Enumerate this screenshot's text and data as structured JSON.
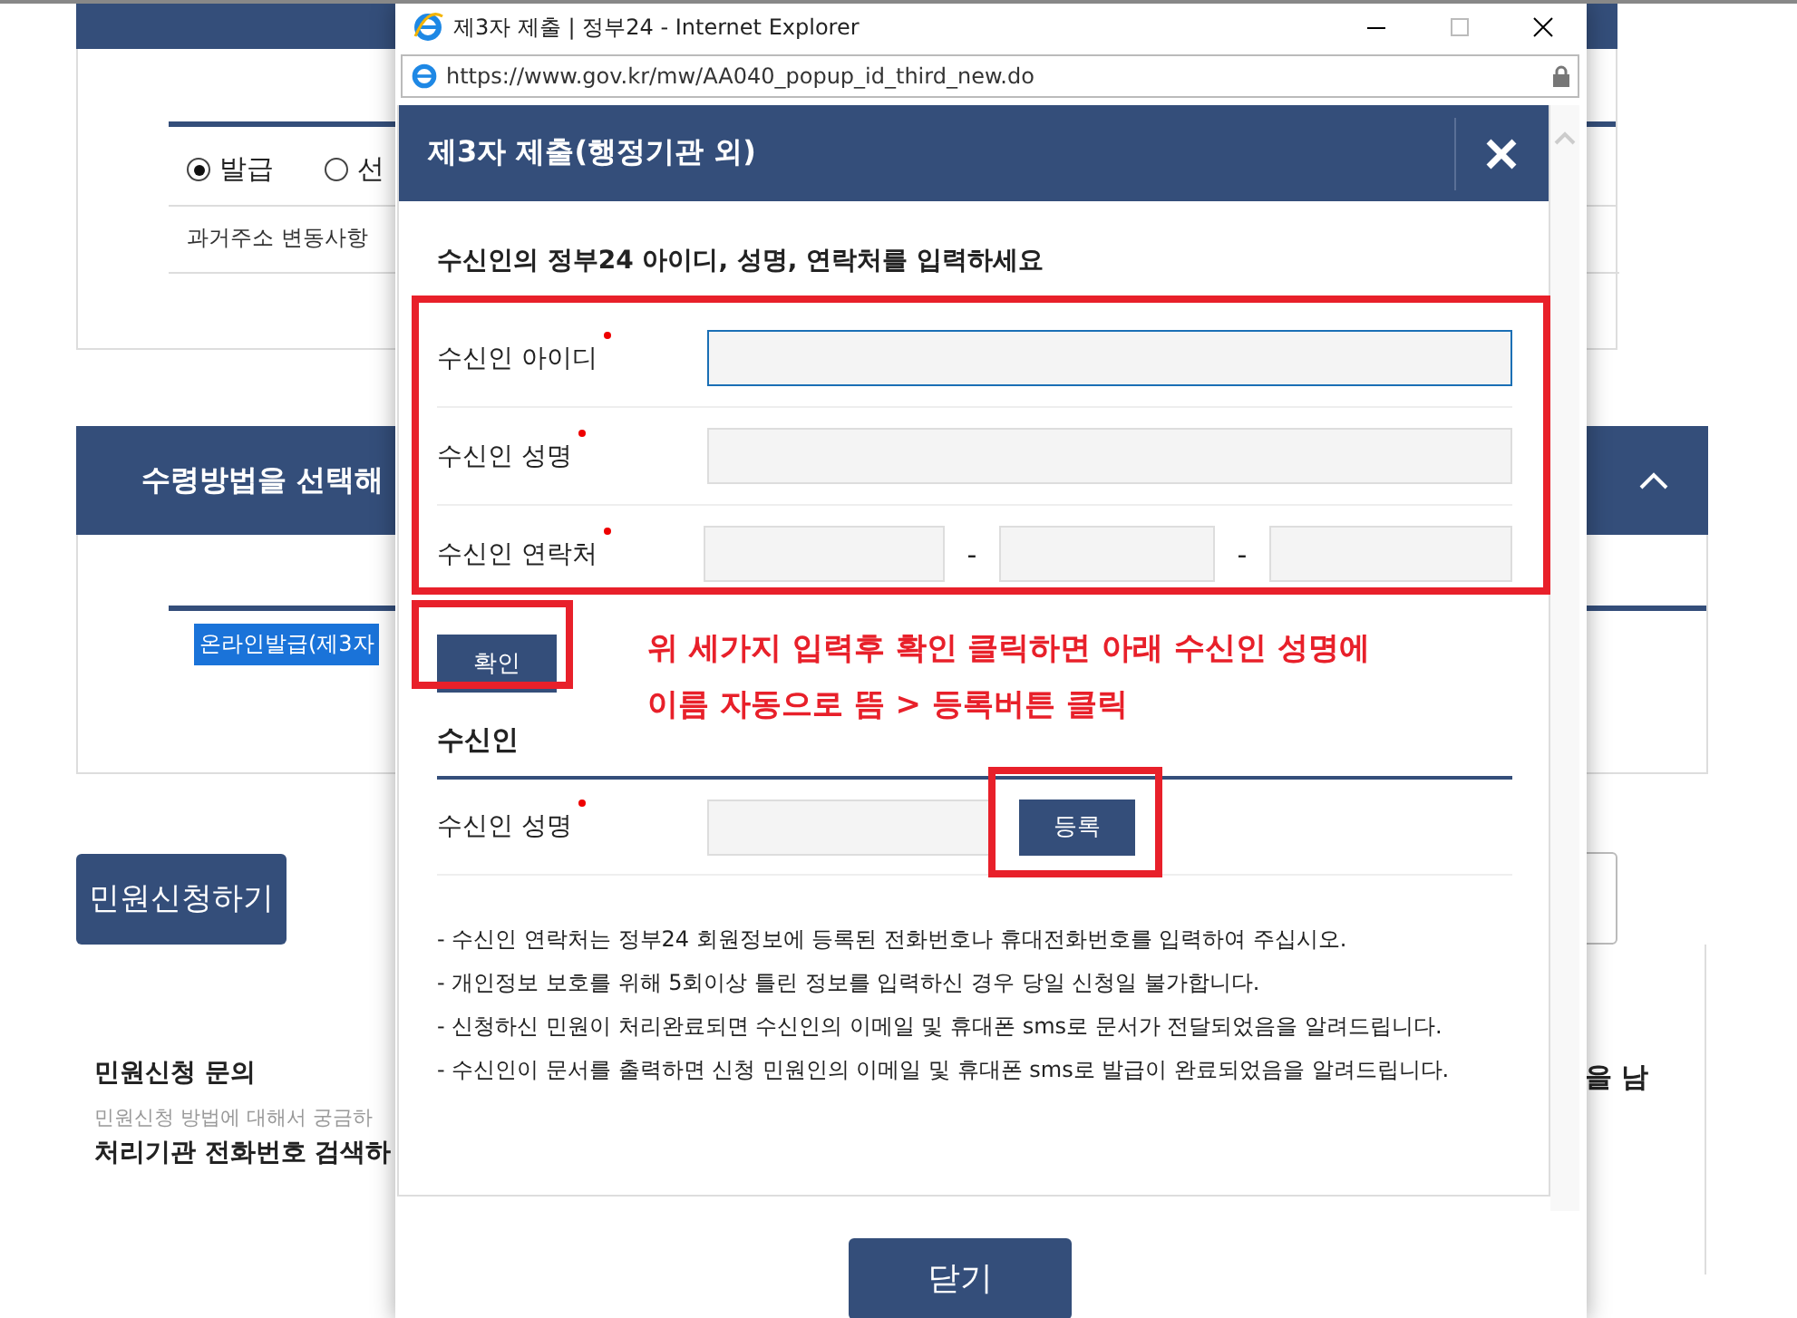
{
  "background": {
    "section_1": {
      "options": [
        {
          "label": "발급",
          "selected": true
        },
        {
          "label": "선",
          "selected": false
        }
      ],
      "note": "과거주소 변동사항"
    },
    "section_2": {
      "title": "수령방법을 선택해",
      "selected_option": "온라인발급(제3자"
    },
    "apply_button": "민원신청하기",
    "inquiry": {
      "title": "민원신청 문의",
      "description": "민원신청 방법에 대해서 궁금하",
      "link": "처리기관 전화번호 검색하"
    },
    "right_text": "을 남"
  },
  "popup": {
    "window_title": "제3자 제출 | 정부24 - Internet Explorer",
    "url": "https://www.gov.kr/mw/AA040_popup_id_third_new.do",
    "header": "제3자 제출(행정기관 외)",
    "instruction": "수신인의 정부24 아이디, 성명, 연락처를 입력하세요",
    "fields": [
      {
        "label": "수신인 아이디",
        "kind": "text",
        "required": true,
        "focused": true
      },
      {
        "label": "수신인 성명",
        "kind": "text",
        "required": true,
        "focused": false
      },
      {
        "label": "수신인 연락처",
        "kind": "phone",
        "required": true,
        "focused": false,
        "separators": [
          "-",
          "-"
        ]
      }
    ],
    "confirm_button": "확인",
    "annotation": [
      "위 세가지 입력후 확인 클릭하면 아래 수신인 성명에",
      "이름 자동으로 뜸 > 등록버튼 클릭"
    ],
    "recipient_section": "수신인",
    "recipient_field": {
      "label": "수신인 성명",
      "required": true
    },
    "register_button": "등록",
    "notes": [
      "- 수신인 연락처는 정부24 회원정보에 등록된 전화번호나 휴대전화번호를 입력하여 주십시오.",
      "- 개인정보 보호를 위해 5회이상 틀린 정보를 입력하신 경우 당일 신청일 불가합니다.",
      "- 신청하신 민원이 처리완료되면 수신인의 이메일 및 휴대폰 sms로 문서가 전달되었음을 알려드립니다.",
      "- 수신인이 문서를 출력하면 신청 민원인의 이메일 및 휴대폰 sms로 발급이 완료되었음을 알려드립니다."
    ],
    "close_button": "닫기"
  }
}
